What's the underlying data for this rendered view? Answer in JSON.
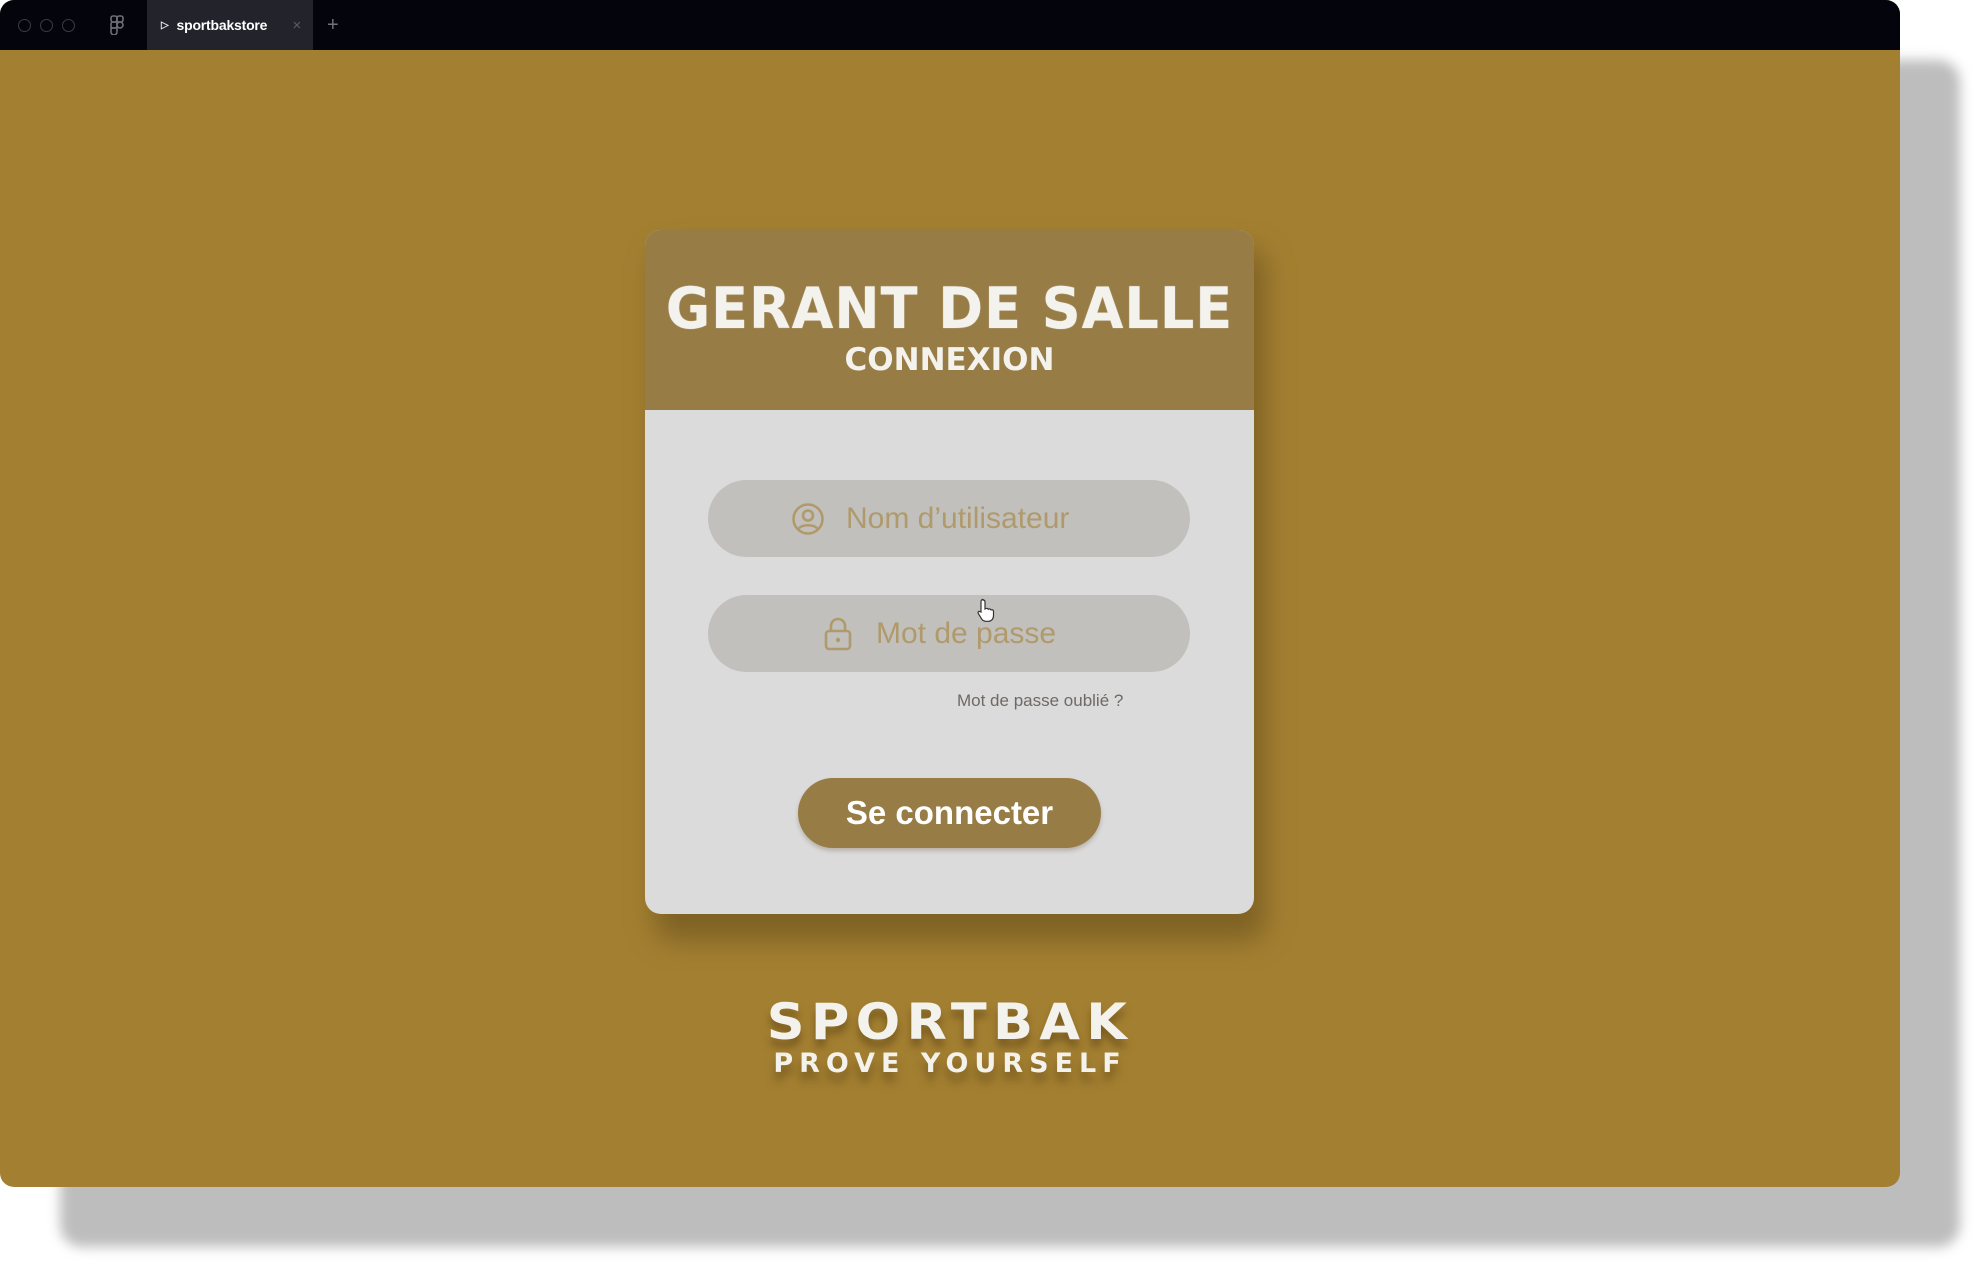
{
  "window": {
    "tab": {
      "title": "sportbakstore",
      "play_glyph": "▷",
      "close_glyph": "×"
    },
    "add_tab_glyph": "+"
  },
  "login": {
    "header": {
      "title": "GERANT DE SALLE",
      "subtitle": "CONNEXION"
    },
    "username": {
      "placeholder": "Nom d’utilisateur",
      "icon": "user-circle-icon"
    },
    "password": {
      "placeholder": "Mot de passe",
      "icon": "lock-icon"
    },
    "forgot_password": "Mot de passe oublié ?",
    "submit_label": "Se connecter"
  },
  "brand": {
    "name": "SPORTBAK",
    "tagline": "PROVE YOURSELF"
  },
  "colors": {
    "background": "#a37f31",
    "header": "#977c46",
    "card": "#dcdbdc",
    "field": "#c1c0bd",
    "placeholder": "#b09a6b"
  }
}
